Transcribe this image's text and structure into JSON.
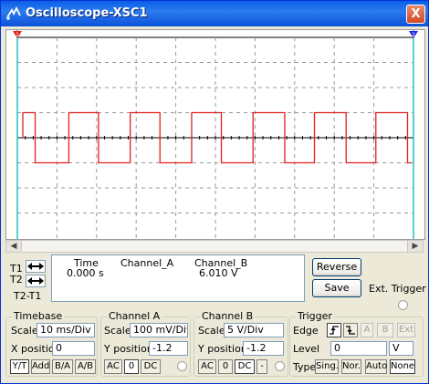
{
  "window": {
    "title": "Oscilloscope-XSC1",
    "close_label": "X"
  },
  "icons": {
    "title": "scope-probe-icon",
    "close": "close-icon",
    "cursor_left": "arrow-left-icon",
    "cursor_right": "arrow-right-icon"
  },
  "colors": {
    "trace": "#E02020",
    "cursor1": "#E02020",
    "cursor2": "#2020E0",
    "cursor_line": "#20C0C0",
    "grid": "#9A9A9A",
    "axis": "#000000",
    "titlebar": "#0A5FE8"
  },
  "cursors": {
    "t1": "T1",
    "t2": "T2",
    "t2_t1": "T2-T1",
    "t1_marker": "1",
    "t2_marker": "2"
  },
  "readout": {
    "headers": {
      "time": "Time",
      "channel_a": "Channel_A",
      "channel_b": "Channel_B"
    },
    "row": {
      "time": "0.000 s",
      "channel_a": "",
      "channel_b": "6.010 V"
    }
  },
  "buttons": {
    "reverse": "Reverse",
    "save": "Save",
    "ext_trigger": "Ext. Trigger"
  },
  "timebase": {
    "title": "Timebase",
    "scale_label": "Scale",
    "scale": "10 ms/Div",
    "xpos_label": "X position",
    "xpos": "0",
    "modes": [
      "Y/T",
      "Add",
      "B/A",
      "A/B"
    ],
    "active_mode": "Y/T"
  },
  "channel_a": {
    "title": "Channel A",
    "scale_label": "Scale",
    "scale": "100 mV/Div",
    "ypos_label": "Y position",
    "ypos": "-1.2",
    "coupling": [
      "AC",
      "0",
      "DC"
    ],
    "active_coupling": "0"
  },
  "channel_b": {
    "title": "Channel B",
    "scale_label": "Scale",
    "scale": "5  V/Div",
    "ypos_label": "Y position",
    "ypos": "-1.2",
    "coupling": [
      "AC",
      "0",
      "DC",
      "-"
    ],
    "active_coupling": "DC"
  },
  "trigger": {
    "title": "Trigger",
    "edge_label": "Edge",
    "edges": [
      "rising-edge-icon",
      "falling-edge-icon"
    ],
    "sources": [
      "A",
      "B",
      "Ext"
    ],
    "level_label": "Level",
    "level": "0",
    "level_unit": "V",
    "type_label": "Type",
    "types": [
      "Sing.",
      "Nor.",
      "Auto",
      "None"
    ],
    "active_type": "None"
  },
  "chart_data": {
    "type": "line",
    "grid": true,
    "divisions": {
      "x": 10,
      "y": 8
    },
    "series": [
      {
        "values_div": [
          1,
          1,
          -1,
          -1,
          1,
          1,
          -1,
          -1,
          1,
          1,
          -1,
          -1,
          1,
          1,
          -1,
          -1,
          1,
          1,
          -1,
          -1,
          1,
          1,
          -1,
          -1,
          1,
          1,
          -1,
          -1,
          1,
          1
        ],
        "start_div": 0.45,
        "transition_div": [
          0.45,
          1.3,
          2.05,
          2.85,
          3.6,
          4.4,
          5.15,
          5.95,
          6.75,
          7.5,
          8.3,
          9.05,
          9.85
        ]
      }
    ]
  }
}
